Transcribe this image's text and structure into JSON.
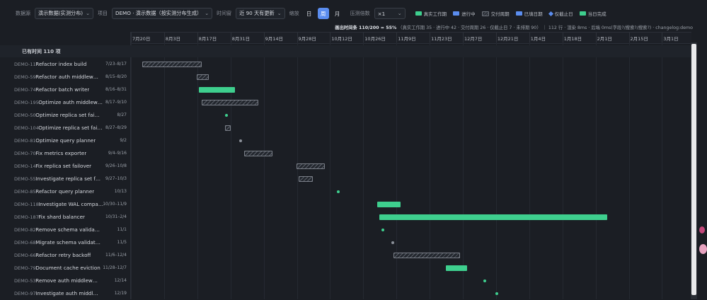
{
  "toolbar": {
    "datasource_label": "数据源",
    "datasource_value": "演示数据(实测分布)",
    "project_label": "项目",
    "project_value": "DEMO · 演示数据（按实测分布生成）",
    "timewindow_label": "时间窗",
    "timewindow_value": "近 90 天有更新",
    "scale_label": "缩放",
    "scale_day": "日",
    "scale_week": "周",
    "scale_month": "月",
    "compress_label": "压测倍数",
    "compress_value": "×1",
    "legend": [
      {
        "label": "真实工作期",
        "color": "#3ecf8e",
        "kind": "solid"
      },
      {
        "label": "进行中",
        "color": "#5b8def",
        "kind": "solid"
      },
      {
        "label": "交付周期",
        "color": "#6d727a",
        "kind": "hatch"
      },
      {
        "label": "已填日期",
        "color": "#5b8def",
        "kind": "solid"
      },
      {
        "label": "仅截止日",
        "color": "#5b8def",
        "kind": "diamond"
      },
      {
        "label": "当日完成",
        "color": "#3ecf8e",
        "kind": "solid"
      }
    ]
  },
  "summary": {
    "bold": "画出时间条 110/200 = 55%",
    "rest": "（真实工作期 35 · 进行中 42 · 交付周期 26 · 仅截止日 7 · 未排期 90） ｜ 112 行 · 渲染 8ms · 后端 0ms(字段?/搜索?/搜索?) · changelog:demo"
  },
  "dates": [
    "7月20日",
    "8月3日",
    "8月17日",
    "8月31日",
    "9月14日",
    "9月28日",
    "10月12日",
    "10月26日",
    "11月9日",
    "11月23日",
    "12月7日",
    "12月21日",
    "1月4日",
    "1月18日",
    "2月1日",
    "2月15日",
    "3月1日"
  ],
  "group_header": "已有时间 110 项",
  "rows": [
    {
      "id": "DEMO-11",
      "title": "Refactor index build",
      "range": "7/23–8/17",
      "kind": "hatch",
      "start": 3,
      "end": 28
    },
    {
      "id": "DEMO-59",
      "title": "Refactor auth middleware",
      "range": "8/15–8/20",
      "kind": "hatch",
      "start": 26,
      "end": 31
    },
    {
      "id": "DEMO-74",
      "title": "Refactor batch writer",
      "range": "8/16–8/31",
      "kind": "green",
      "start": 27,
      "end": 42
    },
    {
      "id": "DEMO-195",
      "title": "Optimize auth middleware",
      "range": "8/17–9/10",
      "kind": "hatch",
      "start": 28,
      "end": 52
    },
    {
      "id": "DEMO-50",
      "title": "Optimize replica set failover",
      "range": "8/27",
      "kind": "dot-green",
      "start": 38
    },
    {
      "id": "DEMO-104",
      "title": "Optimize replica set failover",
      "range": "8/27–8/29",
      "kind": "hatch",
      "start": 38,
      "end": 40
    },
    {
      "id": "DEMO-81",
      "title": "Optimize query planner",
      "range": "9/2",
      "kind": "dot-gray",
      "start": 44
    },
    {
      "id": "DEMO-70",
      "title": "Fix metrics exporter",
      "range": "9/4–9/16",
      "kind": "hatch",
      "start": 46,
      "end": 58
    },
    {
      "id": "DEMO-14",
      "title": "Fix replica set failover",
      "range": "9/26–10/8",
      "kind": "hatch",
      "start": 68,
      "end": 80
    },
    {
      "id": "DEMO-55",
      "title": "Investigate replica set failover",
      "range": "9/27–10/3",
      "kind": "hatch",
      "start": 69,
      "end": 75
    },
    {
      "id": "DEMO-85",
      "title": "Refactor query planner",
      "range": "10/13",
      "kind": "dot-green",
      "start": 85
    },
    {
      "id": "DEMO-118",
      "title": "Investigate WAL compaction",
      "range": "10/30–11/9",
      "kind": "green",
      "start": 102,
      "end": 112
    },
    {
      "id": "DEMO-187",
      "title": "Fix shard balancer",
      "range": "10/31–2/4",
      "kind": "green",
      "start": 103,
      "end": 199
    },
    {
      "id": "DEMO-82",
      "title": "Remove schema validation",
      "range": "11/1",
      "kind": "dot-green",
      "start": 104
    },
    {
      "id": "DEMO-68",
      "title": "Migrate schema validation",
      "range": "11/5",
      "kind": "dot-gray",
      "start": 108
    },
    {
      "id": "DEMO-66",
      "title": "Refactor retry backoff",
      "range": "11/6–12/4",
      "kind": "hatch",
      "start": 109,
      "end": 137
    },
    {
      "id": "DEMO-79",
      "title": "Document cache eviction",
      "range": "11/28–12/7",
      "kind": "green",
      "start": 131,
      "end": 140
    },
    {
      "id": "DEMO-53",
      "title": "Remove auth middleware",
      "range": "12/14",
      "kind": "dot-green",
      "start": 147
    },
    {
      "id": "DEMO-97",
      "title": "Investigate auth middleware",
      "range": "12/19",
      "kind": "dot-green",
      "start": 152
    }
  ]
}
